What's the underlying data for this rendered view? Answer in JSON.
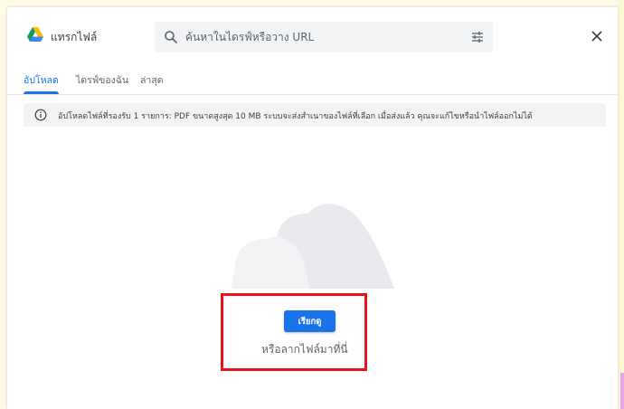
{
  "header": {
    "title": "แทรกไฟล์",
    "search_placeholder": "ค้นหาในไดรฟ์หรือวาง URL"
  },
  "tabs": [
    {
      "label": "อัปโหลด",
      "active": true
    },
    {
      "label": "ไดรฟ์ของฉัน",
      "active": false
    },
    {
      "label": "ล่าสุด",
      "active": false
    }
  ],
  "info": {
    "text": "อัปโหลดไฟล์ที่รองรับ 1 รายการ: PDF ขนาดสูงสุด 10 MB ระบบจะส่งสำเนาของไฟล์ที่เลือก เมื่อส่งแล้ว คุณจะแก้ไขหรือนำไฟล์ออกไม่ได้"
  },
  "upload": {
    "browse_label": "เรียกดู",
    "drag_text": "หรือลากไฟล์มาที่นี่"
  },
  "icons": {
    "logo": "google-drive-icon",
    "search": "search-icon",
    "filter": "filter-sliders-icon",
    "close": "close-icon",
    "info": "info-icon",
    "illustration": "cloud-icon"
  },
  "colors": {
    "accent": "#1a73e8",
    "highlight_box": "#e8141b",
    "panel_bg": "#f1f3f4"
  }
}
